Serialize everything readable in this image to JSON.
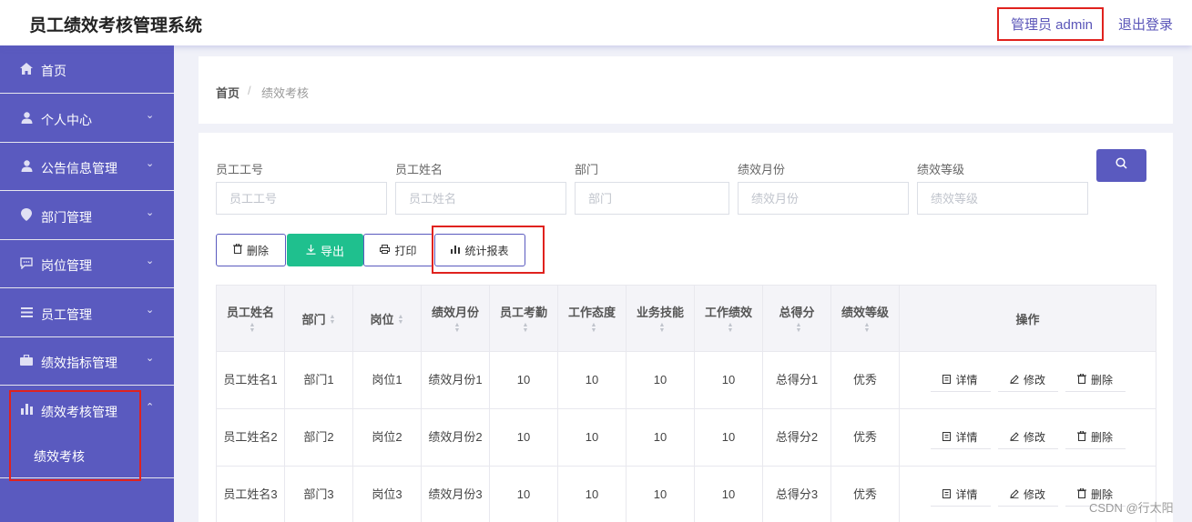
{
  "header": {
    "title": "员工绩效考核管理系统",
    "admin": "管理员 admin",
    "logout": "退出登录"
  },
  "sidebar": {
    "items": [
      {
        "label": "首页"
      },
      {
        "label": "个人中心"
      },
      {
        "label": "公告信息管理"
      },
      {
        "label": "部门管理"
      },
      {
        "label": "岗位管理"
      },
      {
        "label": "员工管理"
      },
      {
        "label": "绩效指标管理"
      },
      {
        "label": "绩效考核管理"
      }
    ],
    "submenu": {
      "label": "绩效考核"
    }
  },
  "breadcrumb": {
    "home": "首页",
    "separator": "/",
    "current": "绩效考核"
  },
  "search": {
    "fields": [
      {
        "label": "员工工号",
        "placeholder": "员工工号"
      },
      {
        "label": "员工姓名",
        "placeholder": "员工姓名"
      },
      {
        "label": "部门",
        "placeholder": "部门"
      },
      {
        "label": "绩效月份",
        "placeholder": "绩效月份"
      },
      {
        "label": "绩效等级",
        "placeholder": "绩效等级"
      }
    ]
  },
  "toolbar": {
    "delete": "删除",
    "export": "导出",
    "print": "打印",
    "stats": "统计报表"
  },
  "table": {
    "headers": [
      "员工姓名",
      "部门",
      "岗位",
      "绩效月份",
      "员工考勤",
      "工作态度",
      "业务技能",
      "工作绩效",
      "总得分",
      "绩效等级",
      "操作"
    ],
    "rows": [
      {
        "name": "员工姓名1",
        "dept": "部门1",
        "post": "岗位1",
        "month": "绩效月份1",
        "attendance": "10",
        "attitude": "10",
        "skill": "10",
        "performance": "10",
        "total": "总得分1",
        "grade": "优秀"
      },
      {
        "name": "员工姓名2",
        "dept": "部门2",
        "post": "岗位2",
        "month": "绩效月份2",
        "attendance": "10",
        "attitude": "10",
        "skill": "10",
        "performance": "10",
        "total": "总得分2",
        "grade": "优秀"
      },
      {
        "name": "员工姓名3",
        "dept": "部门3",
        "post": "岗位3",
        "month": "绩效月份3",
        "attendance": "10",
        "attitude": "10",
        "skill": "10",
        "performance": "10",
        "total": "总得分3",
        "grade": "优秀"
      }
    ],
    "actions": {
      "detail": "详情",
      "edit": "修改",
      "delete": "删除"
    }
  },
  "watermark": "CSDN @行太阳",
  "colors": {
    "primary": "#5a5abf",
    "export_green": "#1fc08e",
    "highlight_red": "#e0221e"
  }
}
